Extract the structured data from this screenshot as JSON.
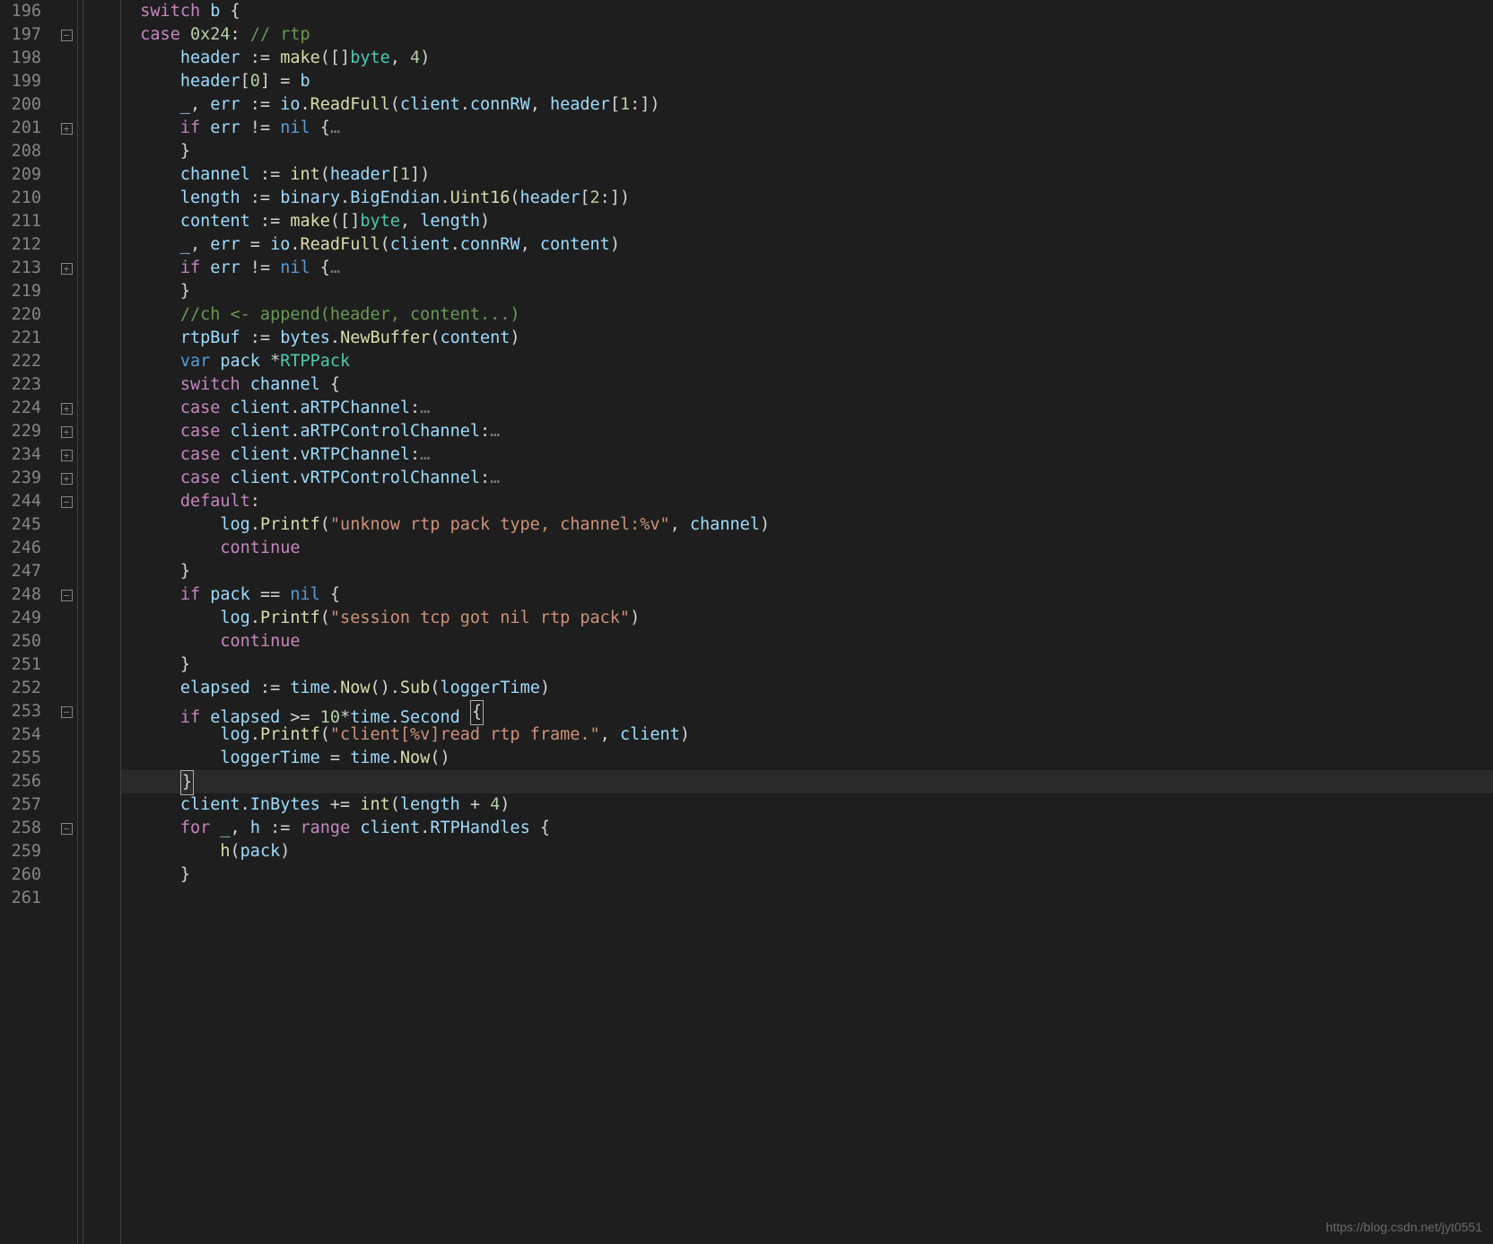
{
  "watermark": "https://blog.csdn.net/jyt0551",
  "gutter": {
    "lines": [
      "196",
      "197",
      "198",
      "199",
      "200",
      "201",
      "208",
      "209",
      "210",
      "211",
      "212",
      "213",
      "219",
      "220",
      "221",
      "222",
      "223",
      "224",
      "229",
      "234",
      "239",
      "244",
      "245",
      "246",
      "247",
      "248",
      "249",
      "250",
      "251",
      "252",
      "253",
      "254",
      "255",
      "256",
      "257",
      "258",
      "259",
      "260",
      "261"
    ]
  },
  "folds": {
    "197": "minus",
    "201": "plus",
    "213": "plus",
    "224": "plus",
    "229": "plus",
    "234": "plus",
    "239": "plus",
    "244": "minus",
    "248": "minus",
    "253": "minus",
    "258": "minus"
  },
  "code_tokens": {
    "l196": [
      [
        "kw",
        "switch"
      ],
      [
        "op",
        " "
      ],
      [
        "id",
        "b"
      ],
      [
        "op",
        " {"
      ]
    ],
    "l197": [
      [
        "kw",
        "case"
      ],
      [
        "op",
        " "
      ],
      [
        "num",
        "0x24"
      ],
      [
        "op",
        ": "
      ],
      [
        "cm",
        "// rtp"
      ]
    ],
    "l198": [
      [
        "id",
        "header"
      ],
      [
        "op",
        " := "
      ],
      [
        "fn",
        "make"
      ],
      [
        "op",
        "([]"
      ],
      [
        "type",
        "byte"
      ],
      [
        "op",
        ", "
      ],
      [
        "num",
        "4"
      ],
      [
        "op",
        ")"
      ]
    ],
    "l199": [
      [
        "id",
        "header"
      ],
      [
        "op",
        "["
      ],
      [
        "num",
        "0"
      ],
      [
        "op",
        "] = "
      ],
      [
        "id",
        "b"
      ]
    ],
    "l200": [
      [
        "id",
        "_"
      ],
      [
        "op",
        ", "
      ],
      [
        "id",
        "err"
      ],
      [
        "op",
        " := "
      ],
      [
        "id",
        "io"
      ],
      [
        "op",
        "."
      ],
      [
        "fn",
        "ReadFull"
      ],
      [
        "op",
        "("
      ],
      [
        "id",
        "client"
      ],
      [
        "op",
        "."
      ],
      [
        "prop",
        "connRW"
      ],
      [
        "op",
        ", "
      ],
      [
        "id",
        "header"
      ],
      [
        "op",
        "["
      ],
      [
        "num",
        "1"
      ],
      [
        "op",
        ":])"
      ]
    ],
    "l201": [
      [
        "kw",
        "if"
      ],
      [
        "op",
        " "
      ],
      [
        "id",
        "err"
      ],
      [
        "op",
        " != "
      ],
      [
        "nil",
        "nil"
      ],
      [
        "op",
        " {"
      ],
      [
        "fold-dots",
        "…"
      ]
    ],
    "l208": [
      [
        "op",
        "}"
      ]
    ],
    "l209": [
      [
        "id",
        "channel"
      ],
      [
        "op",
        " := "
      ],
      [
        "fn",
        "int"
      ],
      [
        "op",
        "("
      ],
      [
        "id",
        "header"
      ],
      [
        "op",
        "["
      ],
      [
        "num",
        "1"
      ],
      [
        "op",
        "])"
      ]
    ],
    "l210": [
      [
        "id",
        "length"
      ],
      [
        "op",
        " := "
      ],
      [
        "id",
        "binary"
      ],
      [
        "op",
        "."
      ],
      [
        "prop",
        "BigEndian"
      ],
      [
        "op",
        "."
      ],
      [
        "fn",
        "Uint16"
      ],
      [
        "op",
        "("
      ],
      [
        "id",
        "header"
      ],
      [
        "op",
        "["
      ],
      [
        "num",
        "2"
      ],
      [
        "op",
        ":])"
      ]
    ],
    "l211": [
      [
        "id",
        "content"
      ],
      [
        "op",
        " := "
      ],
      [
        "fn",
        "make"
      ],
      [
        "op",
        "([]"
      ],
      [
        "type",
        "byte"
      ],
      [
        "op",
        ", "
      ],
      [
        "id",
        "length"
      ],
      [
        "op",
        ")"
      ]
    ],
    "l212": [
      [
        "id",
        "_"
      ],
      [
        "op",
        ", "
      ],
      [
        "id",
        "err"
      ],
      [
        "op",
        " = "
      ],
      [
        "id",
        "io"
      ],
      [
        "op",
        "."
      ],
      [
        "fn",
        "ReadFull"
      ],
      [
        "op",
        "("
      ],
      [
        "id",
        "client"
      ],
      [
        "op",
        "."
      ],
      [
        "prop",
        "connRW"
      ],
      [
        "op",
        ", "
      ],
      [
        "id",
        "content"
      ],
      [
        "op",
        ")"
      ]
    ],
    "l213": [
      [
        "kw",
        "if"
      ],
      [
        "op",
        " "
      ],
      [
        "id",
        "err"
      ],
      [
        "op",
        " != "
      ],
      [
        "nil",
        "nil"
      ],
      [
        "op",
        " {"
      ],
      [
        "fold-dots",
        "…"
      ]
    ],
    "l219": [
      [
        "op",
        "}"
      ]
    ],
    "l220": [
      [
        "cm",
        "//ch <- append(header, content...)"
      ]
    ],
    "l221": [
      [
        "id",
        "rtpBuf"
      ],
      [
        "op",
        " := "
      ],
      [
        "id",
        "bytes"
      ],
      [
        "op",
        "."
      ],
      [
        "fn",
        "NewBuffer"
      ],
      [
        "op",
        "("
      ],
      [
        "id",
        "content"
      ],
      [
        "op",
        ")"
      ]
    ],
    "l222": [
      [
        "var",
        "var"
      ],
      [
        "op",
        " "
      ],
      [
        "id",
        "pack"
      ],
      [
        "op",
        " *"
      ],
      [
        "type",
        "RTPPack"
      ]
    ],
    "l223": [
      [
        "kw",
        "switch"
      ],
      [
        "op",
        " "
      ],
      [
        "id",
        "channel"
      ],
      [
        "op",
        " {"
      ]
    ],
    "l224": [
      [
        "kw",
        "case"
      ],
      [
        "op",
        " "
      ],
      [
        "id",
        "client"
      ],
      [
        "op",
        "."
      ],
      [
        "prop",
        "aRTPChannel"
      ],
      [
        "op",
        ":"
      ],
      [
        "fold-dots",
        "…"
      ]
    ],
    "l229": [
      [
        "kw",
        "case"
      ],
      [
        "op",
        " "
      ],
      [
        "id",
        "client"
      ],
      [
        "op",
        "."
      ],
      [
        "prop",
        "aRTPControlChannel"
      ],
      [
        "op",
        ":"
      ],
      [
        "fold-dots",
        "…"
      ]
    ],
    "l234": [
      [
        "kw",
        "case"
      ],
      [
        "op",
        " "
      ],
      [
        "id",
        "client"
      ],
      [
        "op",
        "."
      ],
      [
        "prop",
        "vRTPChannel"
      ],
      [
        "op",
        ":"
      ],
      [
        "fold-dots",
        "…"
      ]
    ],
    "l239": [
      [
        "kw",
        "case"
      ],
      [
        "op",
        " "
      ],
      [
        "id",
        "client"
      ],
      [
        "op",
        "."
      ],
      [
        "prop",
        "vRTPControlChannel"
      ],
      [
        "op",
        ":"
      ],
      [
        "fold-dots",
        "…"
      ]
    ],
    "l244": [
      [
        "kw",
        "default"
      ],
      [
        "op",
        ":"
      ]
    ],
    "l245": [
      [
        "id",
        "log"
      ],
      [
        "op",
        "."
      ],
      [
        "fn",
        "Printf"
      ],
      [
        "op",
        "("
      ],
      [
        "str",
        "\"unknow rtp pack type, channel:%v\""
      ],
      [
        "op",
        ", "
      ],
      [
        "id",
        "channel"
      ],
      [
        "op",
        ")"
      ]
    ],
    "l246": [
      [
        "kw",
        "continue"
      ]
    ],
    "l247": [
      [
        "op",
        "}"
      ]
    ],
    "l248": [
      [
        "kw",
        "if"
      ],
      [
        "op",
        " "
      ],
      [
        "id",
        "pack"
      ],
      [
        "op",
        " == "
      ],
      [
        "nil",
        "nil"
      ],
      [
        "op",
        " {"
      ]
    ],
    "l249": [
      [
        "id",
        "log"
      ],
      [
        "op",
        "."
      ],
      [
        "fn",
        "Printf"
      ],
      [
        "op",
        "("
      ],
      [
        "str",
        "\"session tcp got nil rtp pack\""
      ],
      [
        "op",
        ")"
      ]
    ],
    "l250": [
      [
        "kw",
        "continue"
      ]
    ],
    "l251": [
      [
        "op",
        "}"
      ]
    ],
    "l252": [
      [
        "id",
        "elapsed"
      ],
      [
        "op",
        " := "
      ],
      [
        "id",
        "time"
      ],
      [
        "op",
        "."
      ],
      [
        "fn",
        "Now"
      ],
      [
        "op",
        "()."
      ],
      [
        "fn",
        "Sub"
      ],
      [
        "op",
        "("
      ],
      [
        "id",
        "loggerTime"
      ],
      [
        "op",
        ")"
      ]
    ],
    "l253": [
      [
        "kw",
        "if"
      ],
      [
        "op",
        " "
      ],
      [
        "id",
        "elapsed"
      ],
      [
        "op",
        " >= "
      ],
      [
        "num",
        "10"
      ],
      [
        "op",
        "*"
      ],
      [
        "id",
        "time"
      ],
      [
        "op",
        "."
      ],
      [
        "prop",
        "Second"
      ],
      [
        "op",
        " "
      ],
      [
        "cursor",
        "{"
      ]
    ],
    "l254": [
      [
        "id",
        "log"
      ],
      [
        "op",
        "."
      ],
      [
        "fn",
        "Printf"
      ],
      [
        "op",
        "("
      ],
      [
        "str",
        "\"client[%v]read rtp frame.\""
      ],
      [
        "op",
        ", "
      ],
      [
        "id",
        "client"
      ],
      [
        "op",
        ")"
      ]
    ],
    "l255": [
      [
        "id",
        "loggerTime"
      ],
      [
        "op",
        " = "
      ],
      [
        "id",
        "time"
      ],
      [
        "op",
        "."
      ],
      [
        "fn",
        "Now"
      ],
      [
        "op",
        "()"
      ]
    ],
    "l256": [
      [
        "cursor",
        "}"
      ]
    ],
    "l257": [
      [
        "id",
        "client"
      ],
      [
        "op",
        "."
      ],
      [
        "prop",
        "InBytes"
      ],
      [
        "op",
        " += "
      ],
      [
        "fn",
        "int"
      ],
      [
        "op",
        "("
      ],
      [
        "id",
        "length"
      ],
      [
        "op",
        " + "
      ],
      [
        "num",
        "4"
      ],
      [
        "op",
        ")"
      ]
    ],
    "l258": [
      [
        "kw",
        "for"
      ],
      [
        "op",
        " "
      ],
      [
        "id",
        "_"
      ],
      [
        "op",
        ", "
      ],
      [
        "id",
        "h"
      ],
      [
        "op",
        " := "
      ],
      [
        "kw",
        "range"
      ],
      [
        "op",
        " "
      ],
      [
        "id",
        "client"
      ],
      [
        "op",
        "."
      ],
      [
        "prop",
        "RTPHandles"
      ],
      [
        "op",
        " {"
      ]
    ],
    "l259": [
      [
        "fn",
        "h"
      ],
      [
        "op",
        "("
      ],
      [
        "id",
        "pack"
      ],
      [
        "op",
        ")"
      ]
    ],
    "l260": [
      [
        "op",
        "}"
      ]
    ],
    "l261": []
  },
  "indents": {
    "l196": 5,
    "l197": 5,
    "l198": 6,
    "l199": 6,
    "l200": 6,
    "l201": 6,
    "l208": 6,
    "l209": 6,
    "l210": 6,
    "l211": 6,
    "l212": 6,
    "l213": 6,
    "l219": 6,
    "l220": 6,
    "l221": 6,
    "l222": 6,
    "l223": 6,
    "l224": 6,
    "l229": 6,
    "l234": 6,
    "l239": 6,
    "l244": 6,
    "l245": 7,
    "l246": 7,
    "l247": 6,
    "l248": 6,
    "l249": 7,
    "l250": 7,
    "l251": 6,
    "l252": 6,
    "l253": 6,
    "l254": 7,
    "l255": 7,
    "l256": 6,
    "l257": 6,
    "l258": 6,
    "l259": 7,
    "l260": 6,
    "l261": 0
  }
}
